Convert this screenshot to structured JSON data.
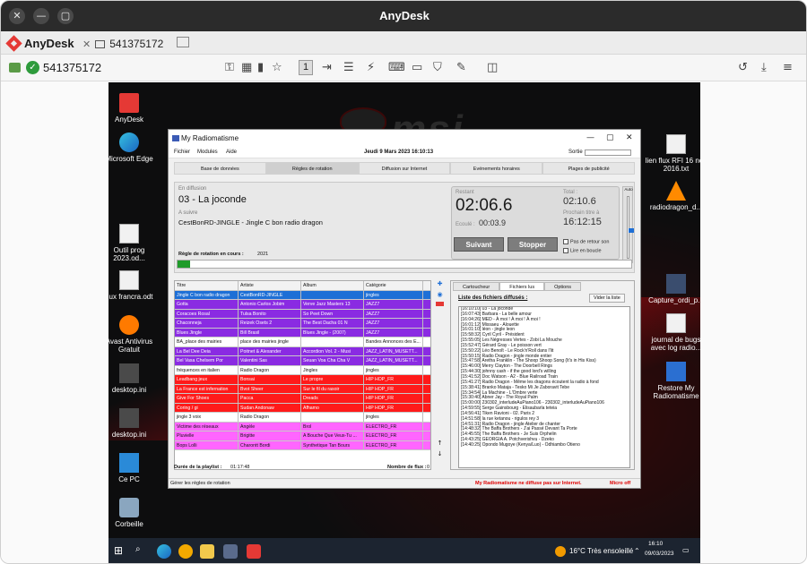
{
  "window": {
    "title": "AnyDesk",
    "close": "✕",
    "minimize": "—",
    "maximize": "▢"
  },
  "tabbar": {
    "brand": "AnyDesk",
    "tab_label": "541375172",
    "tab_close": "✕"
  },
  "addressbar": {
    "remote_id": "541375172",
    "display_number": "1"
  },
  "desktop": {
    "icons_left": [
      "AnyDesk",
      "Microsoft Edge",
      "Outil prog 2023.od...",
      "flux francra.odt",
      "Avast Antivirus Gratuit",
      "desktop.ini",
      "desktop.ini",
      "Ce PC",
      "Corbeille"
    ],
    "icons_right": [
      "lien flux RFI 16 nov 2016.txt",
      "radiodragon_d...",
      "Capture_ordi_p...",
      "journal de bugs avec log radio...",
      "Restore My Radiomatisme"
    ],
    "wallpaper_brand": "msi"
  },
  "app": {
    "title": "My Radiomatisme",
    "menu": [
      "Fichier",
      "Modules",
      "Aide"
    ],
    "date_time": "Jeudi 9 Mars 2023    16:10:13",
    "sortie_label": "Sortie :",
    "tabs": [
      "Base de données",
      "Règles de rotation",
      "Diffusion sur Internet",
      "Evénements horaires",
      "Plages de publicité"
    ],
    "on_air": {
      "label": "En diffusion",
      "title": "03 - La joconde",
      "next_label": "A suivre",
      "next_title": "CestBonRD-JINGLE - Jingle C bon radio dragon",
      "rule_label": "Règle de rotation en cours :",
      "rule_value": "2021"
    },
    "timers": {
      "remaining_label": "Restant",
      "remaining": "02:06.6",
      "elapsed_label": "Ecoulé :",
      "elapsed": "00:03.9",
      "total_label": "Total :",
      "total": "02:10.6",
      "next_label": "Prochain titre à",
      "next_time": "16:12:15",
      "btn_next": "Suivant",
      "btn_stop": "Stopper",
      "chk_return": "Pas de retour son",
      "chk_loop": "Lire en boucle",
      "auto_label": "Auto"
    },
    "playlist": {
      "headers": [
        "Titre",
        "Artiste",
        "Album",
        "Catégorie"
      ],
      "rows": [
        {
          "cells": [
            "Jingle C bon radio dragon",
            "CestBonRD-JINGLE",
            "",
            "jingles"
          ],
          "bg": "#1e6fd6",
          "fg": "#ffffff"
        },
        {
          "cells": [
            "Gotta",
            "Antonio Carlos Jobim",
            "Verve Jazz Masters 13",
            "JAZZ7"
          ],
          "bg": "#8a2be2",
          "fg": "#ffffff"
        },
        {
          "cells": [
            "Coracoes Rosal",
            "Tulsa Bonito",
            "So Peet Down",
            "JAZZ7"
          ],
          "bg": "#8a2be2",
          "fg": "#ffffff"
        },
        {
          "cells": [
            "Chaconneja",
            "Reizek Osets 2",
            "The Best Dacha  01 N",
            "JAZZ7"
          ],
          "bg": "#8a2be2",
          "fg": "#ffffff"
        },
        {
          "cells": [
            "Blues Jingle",
            "Bill Brasil",
            "Blues Jingle - (2007)",
            "JAZZ7"
          ],
          "bg": "#8a2be2",
          "fg": "#ffffff"
        },
        {
          "cells": [
            "BA_place des mairies",
            "place des mairies jingle",
            "",
            "Bandes Annonces des E..."
          ],
          "bg": "#ffffff",
          "fg": "#111111"
        },
        {
          "cells": [
            "La Bel Dee Deia",
            "Poitnet & Alexander",
            "Accordion Vol. 2 - Musi",
            "JAZZ_LATIN_MUSETT..."
          ],
          "bg": "#8a2be2",
          "fg": "#ffffff"
        },
        {
          "cells": [
            "Bel Vasa Chelsem Por",
            "Valentini Sas",
            "Seuan Voa Cha Cha V",
            "JAZZ_LATIN_MUSETT..."
          ],
          "bg": "#8a2be2",
          "fg": "#ffffff"
        },
        {
          "cells": [
            "fréquences en italien",
            "Radio Dragon",
            "Jingles",
            "jingles"
          ],
          "bg": "#ffffff",
          "fg": "#111111"
        },
        {
          "cells": [
            "Leadbang jeux",
            "Bonsai",
            "Le propre",
            "HIP HOP_FR"
          ],
          "bg": "#ff1a1a",
          "fg": "#ffffff"
        },
        {
          "cells": [
            "La France est infernation",
            "Bvot Sheer",
            "Sur le fil du rasoir",
            "HIP HOP_FR"
          ],
          "bg": "#ff1a1a",
          "fg": "#ffffff"
        },
        {
          "cells": [
            "Give For Shoes",
            "Pacca",
            "Dreads",
            "HIP HOP_FR"
          ],
          "bg": "#ff1a1a",
          "fg": "#ffffff"
        },
        {
          "cells": [
            "Coring / gi",
            "Sudan Andonaw",
            "Afhamo",
            "HIP HOP_FR"
          ],
          "bg": "#ff1a1a",
          "fg": "#ffffff"
        },
        {
          "cells": [
            "jingle 3 voix",
            "Radio Dragon",
            "",
            "jingles"
          ],
          "bg": "#ffffff",
          "fg": "#111111"
        },
        {
          "cells": [
            "Victime des réseaux",
            "Angèle",
            "Brol",
            "ELECTRO_FR"
          ],
          "bg": "#ff66ff",
          "fg": "#111111"
        },
        {
          "cells": [
            "Pluvielle",
            "Brigitte",
            "A Bouche Que Veux-Tu ...",
            "ELECTRO_FR"
          ],
          "bg": "#ff66ff",
          "fg": "#111111"
        },
        {
          "cells": [
            "Bops Lolli",
            "Charontt Bordi",
            "Synthetique Tan Bours",
            "ELECTRO_FR"
          ],
          "bg": "#ff66ff",
          "fg": "#111111"
        }
      ],
      "duration_label": "Durée de la playlist :",
      "duration": "01:17:48",
      "count_label": "Nombre de flux :",
      "count": "0"
    },
    "right_panel": {
      "tabs": [
        "Cartoucheur",
        "Fichiers lus",
        "Options"
      ],
      "list_title": "Liste des fichiers diffusés :",
      "clear_button": "Vider la liste",
      "log": [
        "[16:10:10] 03 - La joconde",
        "[16:07:43] Barbara - La belle amour",
        "[16:04:26] MED - À moi ! À moi ! À moi !",
        "[16:01:12] Missaeu - Alouette",
        "[16:01:10] léon - jingle leon",
        "[15:58:32] Cyril Cyril - Président",
        "[15:55:05] Les Négresses Vertes - Zobi La Mouche",
        "[15:52:47] Gérard Gray - Le poisson vert",
        "[15:50:22] Léo Benoît - Le Rock'n'Roll dans l'lit",
        "[15:50:15] Radio Dragon - jingle monde  entier",
        "[15:47:58] Aretha Franklin - The Shoop Shoop Song (It's in His Kiss)",
        "[15:46:00] Merry Clayton - The Doorbell Rings",
        "[15:44:30] johnny cash - if the good lord's willing",
        "[15:41:52] Doc Watson - A2 - Blue Railroad Train",
        "[15:41:27] Radio Dragon - Même les dragons écoutent la radio à fond",
        "[15:38:41] Branko Mataja - Tesko Mi Je Zaboravit Tebe",
        "[15:34:54] La Machine - L'Ombre verte",
        "[15:30:40] Abner Jay - The Royal Palm",
        "[15:00:00] 230302_interludeAuPiano106 - 230302_interludeAuPiano106",
        "[14:59:55] Serge Gainsbourg - Elisaubarla teteia",
        "[14:56:41] Tiken Ravioni - 02. Paris 2",
        "[14:51:58] la  rue ketanou - rigulos rey 3",
        "[14:51:31] Radio Dragon - jingle Atelier de chanter",
        "[14:48:32] The Baffa Brothers - J'ai Passé Devant Ta Porte",
        "[14:45:55] The Baffa Brothers - Je Suis Orphelin",
        "[14:43:25] GEORGIA A. Potchverishvu - Dzeko",
        "[14:40:25] Opondo Mugoye (Kenya/Luo) - Odhiambo Otieno"
      ]
    },
    "status": {
      "left": "Gérer les règles de rotation",
      "right": "My Radiomatisme ne diffuse pas sur Internet.",
      "mic": "Micro off"
    }
  },
  "taskbar": {
    "weather": "16°C  Très ensoleillé",
    "time": "16:10",
    "date": "09/03/2023"
  }
}
